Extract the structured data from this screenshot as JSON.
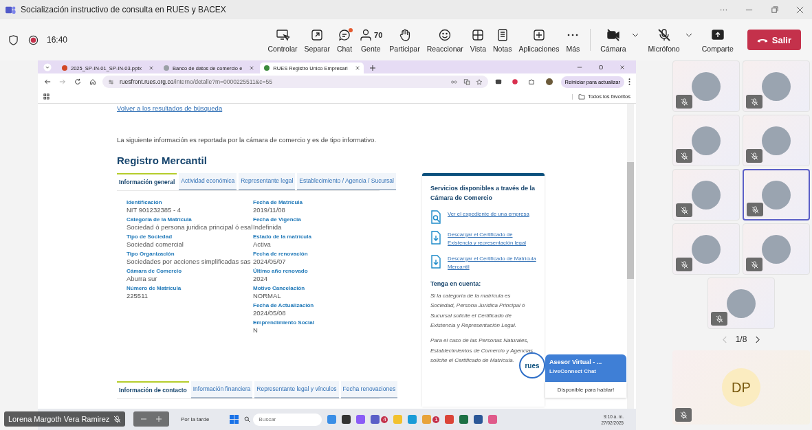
{
  "window": {
    "title": "Socialización instructivo de consulta en RUES y BACEX"
  },
  "meeting_bar": {
    "time": "16:40",
    "recording": true,
    "actions": [
      {
        "kind": "control",
        "label": "Controlar"
      },
      {
        "kind": "popout",
        "label": "Separar"
      },
      {
        "kind": "chat",
        "label": "Chat",
        "alert": true
      },
      {
        "kind": "people",
        "label": "Gente",
        "count": "70"
      },
      {
        "kind": "hand",
        "label": "Participar"
      },
      {
        "kind": "react",
        "label": "Reaccionar"
      },
      {
        "kind": "view",
        "label": "Vista"
      },
      {
        "kind": "notes",
        "label": "Notas"
      },
      {
        "kind": "apps",
        "label": "Aplicaciones"
      },
      {
        "kind": "more",
        "label": "Más"
      }
    ],
    "devices": [
      {
        "kind": "camera",
        "label": "Cámara",
        "off": true
      },
      {
        "kind": "mic",
        "label": "Micrófono",
        "off": true
      },
      {
        "kind": "share",
        "label": "Comparte",
        "off": false
      }
    ],
    "leave": {
      "label": "Salir"
    }
  },
  "browser": {
    "tabs": [
      {
        "kind": "slides",
        "title": "2025_SP-IN-01_SP-IN-03.pptx",
        "selected": false
      },
      {
        "kind": "web",
        "title": "Banco de datos de comercio e",
        "selected": false
      },
      {
        "kind": "rues",
        "title": "RUES Registro Unico Empresari",
        "selected": true
      }
    ],
    "url_host": "ruesfront.rues.org.co",
    "url_path": "/interno/detalle?m=0000225511&c=55",
    "update_button": "Reiniciar para actualizar",
    "bookmarks_label": "Todos los favoritos"
  },
  "page": {
    "back_link": "Volver a los resultados de búsqueda",
    "intro": "La siguiente información es reportada por la cámara de comercio y es de tipo informativo.",
    "heading": "Registro Mercantil",
    "tabs": [
      {
        "label": "Información general",
        "selected": true
      },
      {
        "label": "Actividad económica",
        "selected": false
      },
      {
        "label": "Representante legal",
        "selected": false
      },
      {
        "label": "Establecimiento / Agencia / Sucursal",
        "selected": false
      }
    ],
    "fields_left": [
      {
        "label": "Identificación",
        "value": "NIT 901232385 - 4"
      },
      {
        "label": "Categoria de la Matrícula",
        "value": "Sociedad ó persona juridica principal ó esal"
      },
      {
        "label": "Tipo de Sociedad",
        "value": "Sociedad comercial"
      },
      {
        "label": "Tipo Organización",
        "value": "Sociedades por acciones simplificadas sas"
      },
      {
        "label": "Cámara de Comercio",
        "value": "Aburra sur"
      },
      {
        "label": "Número de Matrícula",
        "value": "225511"
      }
    ],
    "fields_right": [
      {
        "label": "Fecha de Matrícula",
        "value": "2019/11/08"
      },
      {
        "label": "Fecha de Vigencia",
        "value": "Indefinida"
      },
      {
        "label": "Estado de la matrícula",
        "value": "Activa"
      },
      {
        "label": "Fecha de renovación",
        "value": "2024/05/07"
      },
      {
        "label": "Último año renovado",
        "value": "2024"
      },
      {
        "label": "Motivo Cancelación",
        "value": "NORMAL"
      },
      {
        "label": "Fecha de Actualización",
        "value": "2024/05/08"
      },
      {
        "label": "Emprendimiento Social",
        "value": "N"
      }
    ],
    "bottom_tabs": [
      {
        "label": "Información de contacto",
        "selected": true
      },
      {
        "label": "Información financiera",
        "selected": false
      },
      {
        "label": "Representante legal y vínculos",
        "selected": false
      },
      {
        "label": "Fecha renovaciones",
        "selected": false
      }
    ],
    "services": {
      "title": "Servicios disponibles a través de la Cámara de Comercio",
      "links": [
        {
          "kind": "search",
          "text": "Ver el expediente de una empresa"
        },
        {
          "kind": "download",
          "text": "Descargar el Certificado de Existencia y representación legal"
        },
        {
          "kind": "download",
          "text": "Descargar el Certificado de Matrícula Mercantil"
        }
      ],
      "note_title": "Tenga en cuenta:",
      "notes": [
        "Si la categoría de la matrícula es Sociedad, Persona Jurídica Principal ó Sucursal solicite el Certificado de Existencia y Representación Legal.",
        "Para el caso de las Personas Naturales, Establecimientos de Comercio y Agencias solicite el Certificado de Matrícula."
      ]
    },
    "chat_widget": {
      "logo": "rues",
      "title": "Asesor Virtual - ...",
      "subtitle": "LiveConnect Chat",
      "status": "Disponible para hablar!"
    }
  },
  "taskbar": {
    "weather": "Por la tarde",
    "search_placeholder": "Buscar",
    "time": "9:10 a. m.",
    "date": "27/02/2025",
    "apps": [
      {
        "kind": "photos"
      },
      {
        "kind": "taskview"
      },
      {
        "kind": "copilot"
      },
      {
        "kind": "teams",
        "badge": "4"
      },
      {
        "kind": "folder"
      },
      {
        "kind": "edge"
      },
      {
        "kind": "canary",
        "badge": "1"
      },
      {
        "kind": "chrome"
      },
      {
        "kind": "excel"
      },
      {
        "kind": "word"
      },
      {
        "kind": "snip"
      }
    ]
  },
  "presenter": {
    "name": "Lorena Margoth Vera Ramirez",
    "muted": true
  },
  "participants": [
    {
      "muted": true,
      "selected": false
    },
    {
      "muted": true,
      "selected": false
    },
    {
      "muted": true,
      "selected": false
    },
    {
      "muted": true,
      "selected": false
    },
    {
      "muted": true,
      "selected": false
    },
    {
      "muted": true,
      "selected": true
    },
    {
      "muted": true,
      "selected": false
    },
    {
      "muted": true,
      "selected": false
    },
    {
      "muted": true,
      "selected": false
    }
  ],
  "pager": "1/8",
  "self": {
    "initials": "DP",
    "muted": true
  }
}
